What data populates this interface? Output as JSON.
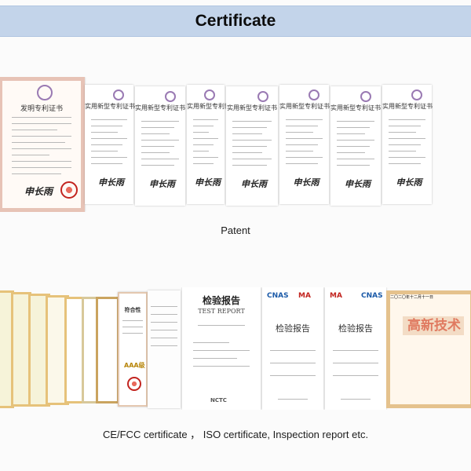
{
  "header": {
    "title": "Certificate"
  },
  "patent_section": {
    "caption": "Patent",
    "main_document": {
      "title": "发明专利证书",
      "signature": "申长雨"
    },
    "utility_documents": [
      {
        "title": "实用新型专利证书",
        "signature": "申长雨"
      },
      {
        "title": "实用新型专利证书",
        "signature": "申长雨"
      },
      {
        "title": "实用新型专利证书",
        "signature": "申长雨"
      },
      {
        "title": "实用新型专利证书",
        "signature": "申长雨"
      },
      {
        "title": "实用新型专利证书",
        "signature": "申长雨"
      },
      {
        "title": "实用新型专利证书",
        "signature": "申长雨"
      },
      {
        "title": "实用新型专利证书",
        "signature": "申长雨"
      }
    ]
  },
  "certificates_section": {
    "caption": "CE/FCC certificate ， ISO certificate, Inspection report etc.",
    "conformity_document": {
      "title": "符合性",
      "badge": "AAA级"
    },
    "test_report": {
      "title": "检验报告",
      "subtitle": "TEST REPORT",
      "footer_logo": "NCTC"
    },
    "inspection_reports": [
      {
        "title": "检验报告",
        "logos": [
          "CNAS",
          "MA"
        ]
      },
      {
        "title": "检验报告",
        "logos": [
          "MA",
          "CNAS"
        ]
      }
    ],
    "award": {
      "title": "高新技术",
      "issue_date": "二〇二〇年十二月十一日"
    }
  },
  "colors": {
    "header_band": "#c3d4ea",
    "seal_red": "#c2241f",
    "award_frame": "#e5c28d",
    "award_text": "#e07a60"
  }
}
